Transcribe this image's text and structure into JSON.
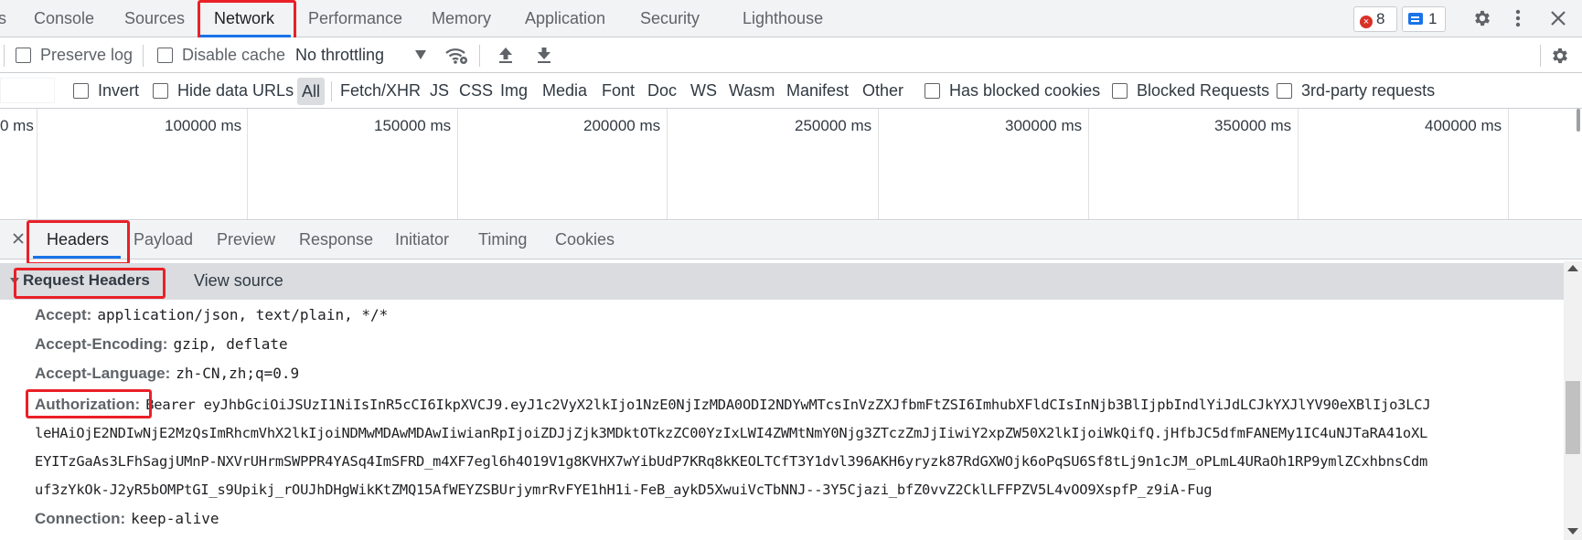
{
  "tabs": {
    "partial": "s",
    "items": [
      "Console",
      "Sources",
      "Network",
      "Performance",
      "Memory",
      "Application",
      "Security",
      "Lighthouse"
    ],
    "active": "Network"
  },
  "status": {
    "errors": "8",
    "messages": "1"
  },
  "toolbar": {
    "preserve_log": "Preserve log",
    "disable_cache": "Disable cache",
    "throttling": "No throttling"
  },
  "filters": {
    "invert": "Invert",
    "hide_data_urls": "Hide data URLs",
    "types": [
      "All",
      "Fetch/XHR",
      "JS",
      "CSS",
      "Img",
      "Media",
      "Font",
      "Doc",
      "WS",
      "Wasm",
      "Manifest",
      "Other"
    ],
    "has_blocked_cookies": "Has blocked cookies",
    "blocked_requests": "Blocked Requests",
    "third_party": "3rd-party requests"
  },
  "timeline": {
    "ticks": [
      "0 ms",
      "100000 ms",
      "150000 ms",
      "200000 ms",
      "250000 ms",
      "300000 ms",
      "350000 ms",
      "400000 ms"
    ]
  },
  "detail_tabs": {
    "items": [
      "Headers",
      "Payload",
      "Preview",
      "Response",
      "Initiator",
      "Timing",
      "Cookies"
    ],
    "active": "Headers"
  },
  "section": {
    "title": "Request Headers",
    "view_source": "View source"
  },
  "headers": [
    {
      "name": "Accept:",
      "value": "application/json, text/plain, */*"
    },
    {
      "name": "Accept-Encoding:",
      "value": "gzip, deflate"
    },
    {
      "name": "Accept-Language:",
      "value": "zh-CN,zh;q=0.9"
    },
    {
      "name": "Authorization:",
      "value": "Bearer eyJhbGciOiJSUzI1NiIsInR5cCI6IkpXVCJ9.eyJ1c2VyX2lkIjo1NzE0NjIzMDA0ODI2NDYwMTcsInVzZXJfbmFtZSI6ImhubXFldCIsInNjb3BlIjpbIndlYiJdLCJkYXJlYV90eXBlIjo3LCJ"
    },
    {
      "name": "Connection:",
      "value": "keep-alive"
    }
  ],
  "auth_continuation": [
    "leHAiOjE2NDIwNjE2MzQsImRhcmVhX2lkIjoiNDMwMDAwMDAwIiwianRpIjoiZDJjZjk3MDktOTkzZC00YzIxLWI4ZWMtNmY0Njg3ZTczZmJjIiwiY2xpZW50X2lkIjoiWkQifQ.jHfbJC5dfmFANEMy1IC4uNJTaRA41oXL",
    "EYITzGaAs3LFhSagjUMnP-NXVrUHrmSWPPR4YASq4ImSFRD_m4XF7egl6h4O19V1g8KVHX7wYibUdP7KRq8kKEOLTCfT3Y1dvl396AKH6yryzk87RdGXWOjk6oPqSU6Sf8tLj9n1cJM_oPLmL4URaOh1RP9ymlZCxhbnsCdm",
    "uf3zYkOk-J2yR5bOMPtGI_s9Upikj_rOUJhDHgWikKtZMQ15AfWEYZSBUrjymrRvFYE1hH1i-FeB_aykD5XwuiVcTbNNJ--3Y5Cjazi_bfZ0vvZ2CklLFFPZV5L4vOO9XspfP_z9iA-Fug"
  ],
  "colors": {
    "accent": "#1a73e8",
    "highlight": "#ea2027",
    "error": "#d93025"
  }
}
